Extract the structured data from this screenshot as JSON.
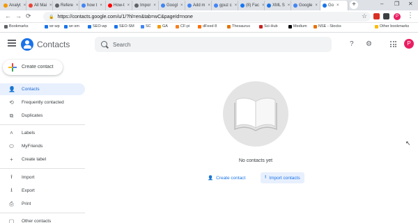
{
  "browser": {
    "tabs": [
      {
        "label": "Analyt",
        "color": "#f29900"
      },
      {
        "label": "All Mai",
        "color": "#ea4335"
      },
      {
        "label": "Refere",
        "color": "#5f6368"
      },
      {
        "label": "how t",
        "color": "#4285f4"
      },
      {
        "label": "How-t",
        "color": "#ff0000"
      },
      {
        "label": "Impor",
        "color": "#5f6368"
      },
      {
        "label": "Googl",
        "color": "#4285f4"
      },
      {
        "label": "Add m",
        "color": "#4285f4"
      },
      {
        "label": "gpuz c",
        "color": "#4285f4"
      },
      {
        "label": "(8) Fac",
        "color": "#1877f2"
      },
      {
        "label": "XML S",
        "color": "#1a73e8"
      },
      {
        "label": "Google",
        "color": "#4285f4"
      },
      {
        "label": "Go",
        "color": "#1a73e8"
      }
    ],
    "new_tab": "+",
    "url": "https://contacts.google.com/u/1/?hl=en&tab=wC&pageId=none",
    "bookmarks": [
      {
        "label": "Bookmarks",
        "color": "#5f6368"
      },
      {
        "label": "wr-wp",
        "color": "#1a73e8"
      },
      {
        "label": "wr-sm",
        "color": "#1a73e8"
      },
      {
        "label": "SEO-wp",
        "color": "#1a73e8"
      },
      {
        "label": "SEO-SM",
        "color": "#1a73e8"
      },
      {
        "label": "SC",
        "color": "#4285f4"
      },
      {
        "label": "GA",
        "color": "#f29900"
      },
      {
        "label": "CF-pi",
        "color": "#f48120"
      },
      {
        "label": "dFeed 8",
        "color": "#ff6d00"
      },
      {
        "label": "Thesaurus",
        "color": "#e37400"
      },
      {
        "label": "Sci-Hub",
        "color": "#c5221f"
      },
      {
        "label": "Medium",
        "color": "#000000"
      },
      {
        "label": "NSE - Stocks",
        "color": "#e8710a"
      },
      {
        "label": "Other bookmarks",
        "color": "#fbbc04"
      }
    ],
    "profile_initial": "P"
  },
  "app": {
    "title": "Contacts",
    "search_placeholder": "Search",
    "avatar_initial": "P"
  },
  "sidebar": {
    "create_label": "Create contact",
    "items": [
      {
        "label": "Contacts",
        "icon": "person-icon",
        "glyph": "👤"
      },
      {
        "label": "Frequently contacted",
        "icon": "history-icon",
        "glyph": "⟲"
      },
      {
        "label": "Duplicates",
        "icon": "duplicates-icon",
        "glyph": "⧉"
      }
    ],
    "labels_header": "Labels",
    "labels": [
      {
        "label": "MyFriends",
        "icon": "label-icon",
        "glyph": "⬭"
      },
      {
        "label": "Create label",
        "icon": "plus-icon",
        "glyph": "+"
      }
    ],
    "tools": [
      {
        "label": "Import",
        "icon": "upload-icon",
        "glyph": "⭱"
      },
      {
        "label": "Export",
        "icon": "download-icon",
        "glyph": "⭳"
      },
      {
        "label": "Print",
        "icon": "print-icon",
        "glyph": "⎙"
      }
    ],
    "other_contacts": "Other contacts"
  },
  "main": {
    "empty_text": "No contacts yet",
    "create_contact": "Create contact",
    "import_contacts": "Import contacts"
  },
  "colors": {
    "accent": "#1a73e8",
    "active_bg": "#e8f0fe"
  }
}
